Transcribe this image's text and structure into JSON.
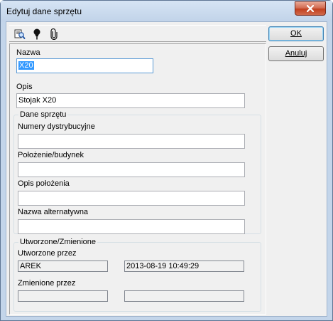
{
  "window": {
    "title": "Edytuj dane sprzętu"
  },
  "toolbar": {
    "icons": [
      "search-icon",
      "pin-icon",
      "paperclip-icon"
    ]
  },
  "form": {
    "name_label": "Nazwa",
    "name_value": "X20",
    "desc_label": "Opis",
    "desc_value": "Stojak X20"
  },
  "equipment": {
    "group_title": "Dane sprzętu",
    "serials_label": "Numery dystrybucyjne",
    "serials_value": "",
    "location_label": "Położenie/budynek",
    "location_value": "",
    "location_desc_label": "Opis położenia",
    "location_desc_value": "",
    "alt_name_label": "Nazwa alternatywna",
    "alt_name_value": ""
  },
  "audit": {
    "group_title": "Utworzone/Zmienione",
    "created_label": "Utworzone przez",
    "created_by": "AREK",
    "created_at": "2013-08-19 10:49:29",
    "modified_label": "Zmienione przez",
    "modified_by": "",
    "modified_at": ""
  },
  "buttons": {
    "ok": "OK",
    "cancel": "Anuluj"
  }
}
